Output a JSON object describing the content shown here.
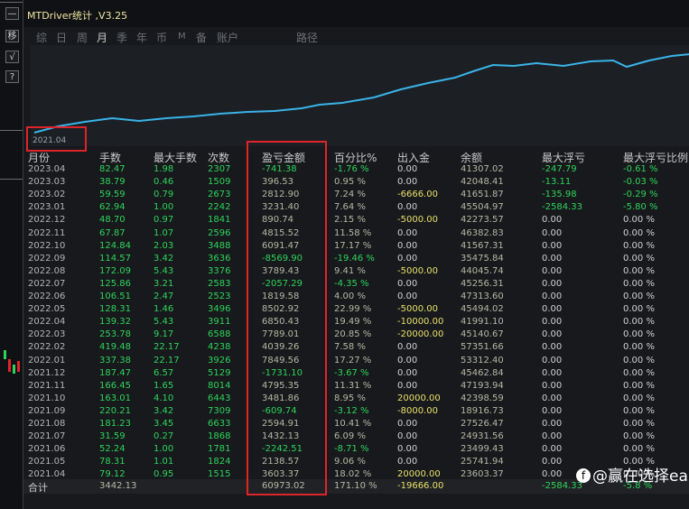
{
  "window": {
    "title": "MTDriver统计 ,V3.25"
  },
  "tabs": [
    {
      "label": "综",
      "active": false
    },
    {
      "label": "日",
      "active": false
    },
    {
      "label": "周",
      "active": false
    },
    {
      "label": "月",
      "active": true
    },
    {
      "label": "季",
      "active": false
    },
    {
      "label": "年",
      "active": false
    },
    {
      "label": "币",
      "active": false
    },
    {
      "label": "M",
      "active": false
    },
    {
      "label": "备",
      "active": false
    },
    {
      "label": "账户",
      "active": false
    },
    {
      "label": "路径",
      "active": false
    }
  ],
  "side_buttons": [
    "移",
    "√",
    "?"
  ],
  "chart": {
    "start_label": "2021.04",
    "line_color": "#39b4e8"
  },
  "columns": [
    "月份",
    "手数",
    "最大手数",
    "次数",
    "盈亏金额",
    "百分比%",
    "出入金",
    "余额",
    "最大浮亏",
    "最大浮亏比例"
  ],
  "rows": [
    {
      "month": "2023.04",
      "lots": "82.47",
      "max_lots": "1.98",
      "count": "2307",
      "pnl": "-741.38",
      "pct": "-1.76 %",
      "flow": "0.00",
      "balance": "41307.02",
      "max_dd": "-247.79",
      "max_dd_pct": "-0.61 %"
    },
    {
      "month": "2023.03",
      "lots": "38.79",
      "max_lots": "0.46",
      "count": "1509",
      "pnl": "396.53",
      "pct": "0.95 %",
      "flow": "0.00",
      "balance": "42048.41",
      "max_dd": "-13.11",
      "max_dd_pct": "-0.03 %"
    },
    {
      "month": "2023.02",
      "lots": "59.59",
      "max_lots": "0.79",
      "count": "2673",
      "pnl": "2812.90",
      "pct": "7.24 %",
      "flow": "-6666.00",
      "balance": "41651.87",
      "max_dd": "-135.98",
      "max_dd_pct": "-0.29 %"
    },
    {
      "month": "2023.01",
      "lots": "62.94",
      "max_lots": "1.00",
      "count": "2242",
      "pnl": "3231.40",
      "pct": "7.64 %",
      "flow": "0.00",
      "balance": "45504.97",
      "max_dd": "-2584.33",
      "max_dd_pct": "-5.80 %"
    },
    {
      "month": "2022.12",
      "lots": "48.70",
      "max_lots": "0.97",
      "count": "1841",
      "pnl": "890.74",
      "pct": "2.15 %",
      "flow": "-5000.00",
      "balance": "42273.57",
      "max_dd": "0.00",
      "max_dd_pct": "0.00 %"
    },
    {
      "month": "2022.11",
      "lots": "67.87",
      "max_lots": "1.07",
      "count": "2596",
      "pnl": "4815.52",
      "pct": "11.58 %",
      "flow": "0.00",
      "balance": "46382.83",
      "max_dd": "0.00",
      "max_dd_pct": "0.00 %"
    },
    {
      "month": "2022.10",
      "lots": "124.84",
      "max_lots": "2.03",
      "count": "3488",
      "pnl": "6091.47",
      "pct": "17.17 %",
      "flow": "0.00",
      "balance": "41567.31",
      "max_dd": "0.00",
      "max_dd_pct": "0.00 %"
    },
    {
      "month": "2022.09",
      "lots": "114.57",
      "max_lots": "3.42",
      "count": "3636",
      "pnl": "-8569.90",
      "pct": "-19.46 %",
      "flow": "0.00",
      "balance": "35475.84",
      "max_dd": "0.00",
      "max_dd_pct": "0.00 %"
    },
    {
      "month": "2022.08",
      "lots": "172.09",
      "max_lots": "5.43",
      "count": "3376",
      "pnl": "3789.43",
      "pct": "9.41 %",
      "flow": "-5000.00",
      "balance": "44045.74",
      "max_dd": "0.00",
      "max_dd_pct": "0.00 %"
    },
    {
      "month": "2022.07",
      "lots": "125.86",
      "max_lots": "3.21",
      "count": "2583",
      "pnl": "-2057.29",
      "pct": "-4.35 %",
      "flow": "0.00",
      "balance": "45256.31",
      "max_dd": "0.00",
      "max_dd_pct": "0.00 %"
    },
    {
      "month": "2022.06",
      "lots": "106.51",
      "max_lots": "2.47",
      "count": "2523",
      "pnl": "1819.58",
      "pct": "4.00 %",
      "flow": "0.00",
      "balance": "47313.60",
      "max_dd": "0.00",
      "max_dd_pct": "0.00 %"
    },
    {
      "month": "2022.05",
      "lots": "128.31",
      "max_lots": "1.46",
      "count": "3496",
      "pnl": "8502.92",
      "pct": "22.99 %",
      "flow": "-5000.00",
      "balance": "45494.02",
      "max_dd": "0.00",
      "max_dd_pct": "0.00 %"
    },
    {
      "month": "2022.04",
      "lots": "139.32",
      "max_lots": "5.43",
      "count": "3911",
      "pnl": "6850.43",
      "pct": "19.49 %",
      "flow": "-10000.00",
      "balance": "41991.10",
      "max_dd": "0.00",
      "max_dd_pct": "0.00 %"
    },
    {
      "month": "2022.03",
      "lots": "253.78",
      "max_lots": "9.17",
      "count": "6588",
      "pnl": "7789.01",
      "pct": "20.85 %",
      "flow": "-20000.00",
      "balance": "45140.67",
      "max_dd": "0.00",
      "max_dd_pct": "0.00 %"
    },
    {
      "month": "2022.02",
      "lots": "419.48",
      "max_lots": "22.17",
      "count": "4238",
      "pnl": "4039.26",
      "pct": "7.58 %",
      "flow": "0.00",
      "balance": "57351.66",
      "max_dd": "0.00",
      "max_dd_pct": "0.00 %"
    },
    {
      "month": "2022.01",
      "lots": "337.38",
      "max_lots": "22.17",
      "count": "3926",
      "pnl": "7849.56",
      "pct": "17.27 %",
      "flow": "0.00",
      "balance": "53312.40",
      "max_dd": "0.00",
      "max_dd_pct": "0.00 %"
    },
    {
      "month": "2021.12",
      "lots": "187.47",
      "max_lots": "6.57",
      "count": "5129",
      "pnl": "-1731.10",
      "pct": "-3.67 %",
      "flow": "0.00",
      "balance": "45462.84",
      "max_dd": "0.00",
      "max_dd_pct": "0.00 %"
    },
    {
      "month": "2021.11",
      "lots": "166.45",
      "max_lots": "1.65",
      "count": "8014",
      "pnl": "4795.35",
      "pct": "11.31 %",
      "flow": "0.00",
      "balance": "47193.94",
      "max_dd": "0.00",
      "max_dd_pct": "0.00 %"
    },
    {
      "month": "2021.10",
      "lots": "163.01",
      "max_lots": "4.10",
      "count": "6443",
      "pnl": "3481.86",
      "pct": "8.95 %",
      "flow": "20000.00",
      "balance": "42398.59",
      "max_dd": "0.00",
      "max_dd_pct": "0.00 %"
    },
    {
      "month": "2021.09",
      "lots": "220.21",
      "max_lots": "3.42",
      "count": "7309",
      "pnl": "-609.74",
      "pct": "-3.12 %",
      "flow": "-8000.00",
      "balance": "18916.73",
      "max_dd": "0.00",
      "max_dd_pct": "0.00 %"
    },
    {
      "month": "2021.08",
      "lots": "181.23",
      "max_lots": "3.45",
      "count": "6633",
      "pnl": "2594.91",
      "pct": "10.41 %",
      "flow": "0.00",
      "balance": "27526.47",
      "max_dd": "0.00",
      "max_dd_pct": "0.00 %"
    },
    {
      "month": "2021.07",
      "lots": "31.59",
      "max_lots": "0.27",
      "count": "1868",
      "pnl": "1432.13",
      "pct": "6.09 %",
      "flow": "0.00",
      "balance": "24931.56",
      "max_dd": "0.00",
      "max_dd_pct": "0.00 %"
    },
    {
      "month": "2021.06",
      "lots": "52.24",
      "max_lots": "1.00",
      "count": "1781",
      "pnl": "-2242.51",
      "pct": "-8.71 %",
      "flow": "0.00",
      "balance": "23499.43",
      "max_dd": "0.00",
      "max_dd_pct": "0.00 %"
    },
    {
      "month": "2021.05",
      "lots": "78.31",
      "max_lots": "1.01",
      "count": "1824",
      "pnl": "2138.57",
      "pct": "9.06 %",
      "flow": "0.00",
      "balance": "25741.94",
      "max_dd": "0.00",
      "max_dd_pct": "0.00 %"
    },
    {
      "month": "2021.04",
      "lots": "79.12",
      "max_lots": "0.95",
      "count": "1515",
      "pnl": "3603.37",
      "pct": "18.02 %",
      "flow": "20000.00",
      "balance": "23603.37",
      "max_dd": "0.00",
      "max_dd_pct": "0.00 %"
    }
  ],
  "total": {
    "label": "合计",
    "lots": "3442.13",
    "pnl": "60973.02",
    "pct": "171.10 %",
    "flow": "-19666.00",
    "max_dd": "-2584.33",
    "max_dd_pct": "-5.8 %"
  },
  "watermark": {
    "logo_glyph": "f",
    "text": "@赢在选择ea"
  },
  "colors": {
    "positive": "#b8b7a3",
    "negative": "#2fd45a",
    "flow": "#e8e06a",
    "highlight": "#e0242a"
  }
}
